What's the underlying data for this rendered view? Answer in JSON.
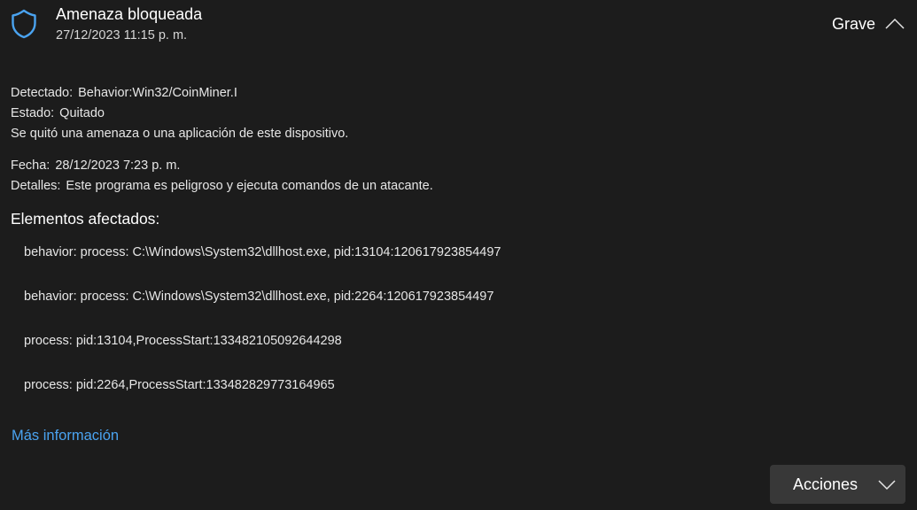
{
  "header": {
    "title": "Amenaza bloqueada",
    "timestamp": "27/12/2023 11:15 p. m.",
    "severity": "Grave",
    "icon": "shield-icon",
    "accent_color": "#4aa3f0"
  },
  "details": {
    "detected_label": "Detectado:",
    "detected_value": "Behavior:Win32/CoinMiner.I",
    "status_label": "Estado:",
    "status_value": "Quitado",
    "status_description": "Se quitó una amenaza o una aplicación de este dispositivo.",
    "date_label": "Fecha:",
    "date_value": "28/12/2023 7:23 p. m.",
    "details_label": "Detalles:",
    "details_value": "Este programa es peligroso y ejecuta comandos de un atacante."
  },
  "affected": {
    "title": "Elementos afectados:",
    "items": [
      "behavior: process: C:\\Windows\\System32\\dllhost.exe, pid:13104:120617923854497",
      "behavior: process: C:\\Windows\\System32\\dllhost.exe, pid:2264:120617923854497",
      "process: pid:13104,ProcessStart:133482105092644298",
      "process: pid:2264,ProcessStart:133482829773164965"
    ]
  },
  "links": {
    "more_info": "Más información"
  },
  "actions": {
    "label": "Acciones"
  }
}
